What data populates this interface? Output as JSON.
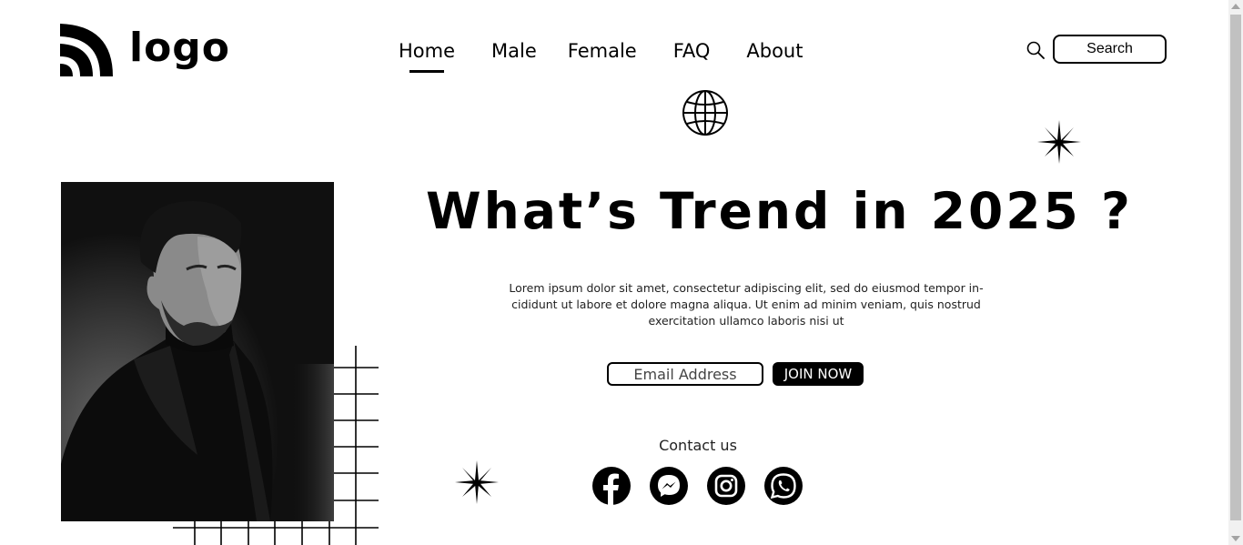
{
  "brand": {
    "logo_text": "logo",
    "logo_icon": "rss-arcs-icon"
  },
  "nav": {
    "items": [
      {
        "label": "Home",
        "active": true
      },
      {
        "label": "Male",
        "active": false
      },
      {
        "label": "Female",
        "active": false
      },
      {
        "label": "FAQ",
        "active": false
      },
      {
        "label": "About",
        "active": false
      }
    ]
  },
  "search": {
    "icon": "search-icon",
    "value": "Search"
  },
  "hero": {
    "title": "What’s Trend in 2025 ?",
    "description": "Lorem ipsum dolor sit amet, consectetur adipiscing elit, sed do eiusmod tempor in-cididunt ut labore et dolore magna aliqua. Ut enim ad minim veniam, quis nostrud exercitation ullamco laboris nisi ut"
  },
  "newsletter": {
    "email_placeholder": "Email Address",
    "join_label": "JOIN NOW"
  },
  "contact": {
    "label": "Contact us",
    "socials": [
      "facebook-icon",
      "messenger-icon",
      "instagram-icon",
      "whatsapp-icon"
    ]
  },
  "decor": {
    "globe": "globe-icon",
    "star": "sparkle-star-icon"
  },
  "colors": {
    "primary": "#000000",
    "background": "#ffffff"
  }
}
